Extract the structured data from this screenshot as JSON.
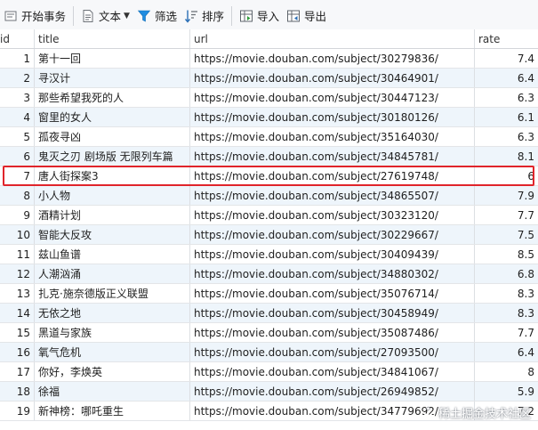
{
  "toolbar": {
    "begin_transaction": "开始事务",
    "text": "文本",
    "filter": "筛选",
    "sort": "排序",
    "import": "导入",
    "export": "导出"
  },
  "columns": [
    "id",
    "title",
    "url",
    "rate"
  ],
  "rows": [
    {
      "id": "1",
      "title": "第十一回",
      "url": "https://movie.douban.com/subject/30279836/",
      "rate": "7.4"
    },
    {
      "id": "2",
      "title": "寻汉计",
      "url": "https://movie.douban.com/subject/30464901/",
      "rate": "6.4"
    },
    {
      "id": "3",
      "title": "那些希望我死的人",
      "url": "https://movie.douban.com/subject/30447123/",
      "rate": "6.3"
    },
    {
      "id": "4",
      "title": "窗里的女人",
      "url": "https://movie.douban.com/subject/30180126/",
      "rate": "6.1"
    },
    {
      "id": "5",
      "title": "孤夜寻凶",
      "url": "https://movie.douban.com/subject/35164030/",
      "rate": "6.3"
    },
    {
      "id": "6",
      "title": "鬼灭之刃 剧场版 无限列车篇",
      "url": "https://movie.douban.com/subject/34845781/",
      "rate": "8.1"
    },
    {
      "id": "7",
      "title": "唐人街探案3",
      "url": "https://movie.douban.com/subject/27619748/",
      "rate": "6"
    },
    {
      "id": "8",
      "title": "小人物",
      "url": "https://movie.douban.com/subject/34865507/",
      "rate": "7.9"
    },
    {
      "id": "9",
      "title": "酒精计划",
      "url": "https://movie.douban.com/subject/30323120/",
      "rate": "7.7"
    },
    {
      "id": "10",
      "title": "智能大反攻",
      "url": "https://movie.douban.com/subject/30229667/",
      "rate": "7.5"
    },
    {
      "id": "11",
      "title": "兹山鱼谱",
      "url": "https://movie.douban.com/subject/30409439/",
      "rate": "8.5"
    },
    {
      "id": "12",
      "title": "人潮汹涌",
      "url": "https://movie.douban.com/subject/34880302/",
      "rate": "6.8"
    },
    {
      "id": "13",
      "title": "扎克·施奈德版正义联盟",
      "url": "https://movie.douban.com/subject/35076714/",
      "rate": "8.3"
    },
    {
      "id": "14",
      "title": "无依之地",
      "url": "https://movie.douban.com/subject/30458949/",
      "rate": "8.3"
    },
    {
      "id": "15",
      "title": "黑道与家族",
      "url": "https://movie.douban.com/subject/35087486/",
      "rate": "7.7"
    },
    {
      "id": "16",
      "title": "氧气危机",
      "url": "https://movie.douban.com/subject/27093500/",
      "rate": "6.4"
    },
    {
      "id": "17",
      "title": "你好，李焕英",
      "url": "https://movie.douban.com/subject/34841067/",
      "rate": "8"
    },
    {
      "id": "18",
      "title": "徐福",
      "url": "https://movie.douban.com/subject/26949852/",
      "rate": "5.9"
    },
    {
      "id": "19",
      "title": "新神榜：哪吒重生",
      "url": "https://movie.douban.com/subject/34779692/",
      "rate": "7.2"
    }
  ],
  "watermark": "稀土掘金技术社区",
  "colors": {
    "highlight_border": "#e0242b",
    "alt_row": "#eef5fb",
    "filter_icon": "#1f8ce0"
  }
}
